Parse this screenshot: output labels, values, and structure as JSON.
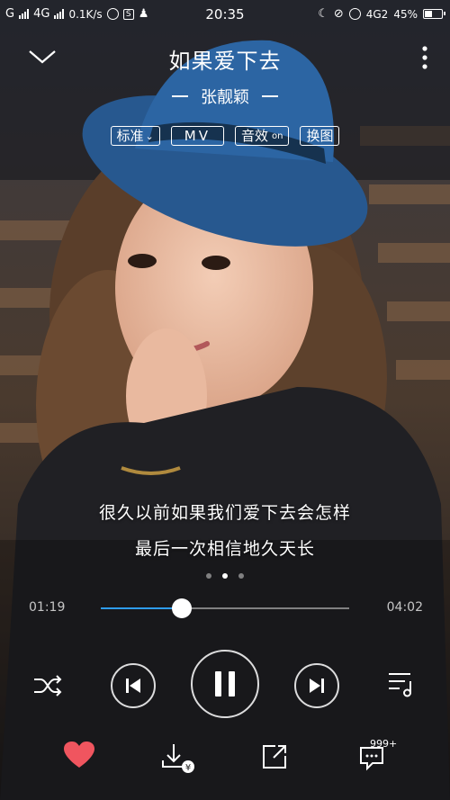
{
  "status_bar": {
    "carrier1": "G",
    "carrier2": "4G",
    "speed": "0.1K/s",
    "time": "20:35",
    "network": "4G2",
    "battery": "45%",
    "battery_level": 0.45
  },
  "song": {
    "title": "如果爱下去",
    "artist": "张靓颖"
  },
  "chips": {
    "quality": "标准",
    "mv": "MV",
    "effect": "音效",
    "effect_state": "on",
    "change_bg": "换图"
  },
  "lyrics": {
    "line1": "很久以前如果我们爱下去会怎样",
    "line2": "最后一次相信地久天长"
  },
  "pager": {
    "count": 3,
    "active": 1
  },
  "progress": {
    "current": "01:19",
    "total": "04:02",
    "fraction": 0.327
  },
  "bottom": {
    "comments_badge": "999+"
  },
  "colors": {
    "accent": "#2e9cf0",
    "heart": "#f0555f",
    "hat": "#2a5f9a"
  }
}
